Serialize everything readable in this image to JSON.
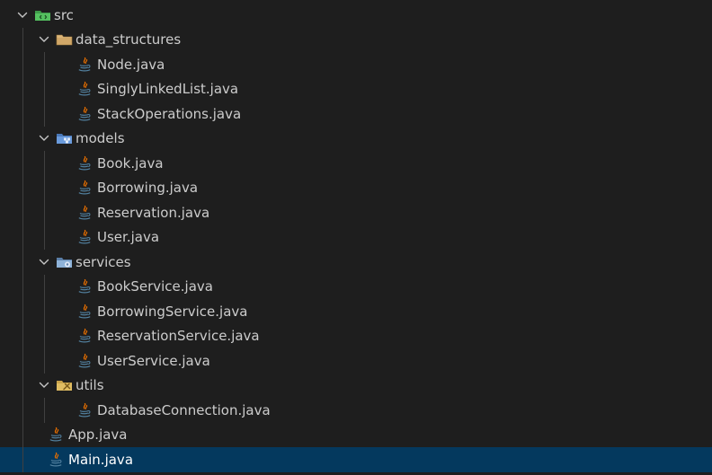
{
  "explorer": {
    "items": [
      {
        "label": "src",
        "kind": "folder",
        "icon": "src-folder-icon",
        "depth": 0,
        "expanded": true
      },
      {
        "label": "data_structures",
        "kind": "folder",
        "icon": "folder-icon",
        "depth": 1,
        "expanded": true
      },
      {
        "label": "Node.java",
        "kind": "file",
        "icon": "java-file-icon",
        "depth": 2
      },
      {
        "label": "SinglyLinkedList.java",
        "kind": "file",
        "icon": "java-file-icon",
        "depth": 2
      },
      {
        "label": "StackOperations.java",
        "kind": "file",
        "icon": "java-file-icon",
        "depth": 2
      },
      {
        "label": "models",
        "kind": "folder",
        "icon": "models-folder-icon",
        "depth": 1,
        "expanded": true
      },
      {
        "label": "Book.java",
        "kind": "file",
        "icon": "java-file-icon",
        "depth": 2
      },
      {
        "label": "Borrowing.java",
        "kind": "file",
        "icon": "java-file-icon",
        "depth": 2
      },
      {
        "label": "Reservation.java",
        "kind": "file",
        "icon": "java-file-icon",
        "depth": 2
      },
      {
        "label": "User.java",
        "kind": "file",
        "icon": "java-file-icon",
        "depth": 2
      },
      {
        "label": "services",
        "kind": "folder",
        "icon": "services-folder-icon",
        "depth": 1,
        "expanded": true
      },
      {
        "label": "BookService.java",
        "kind": "file",
        "icon": "java-file-icon",
        "depth": 2
      },
      {
        "label": "BorrowingService.java",
        "kind": "file",
        "icon": "java-file-icon",
        "depth": 2
      },
      {
        "label": "ReservationService.java",
        "kind": "file",
        "icon": "java-file-icon",
        "depth": 2
      },
      {
        "label": "UserService.java",
        "kind": "file",
        "icon": "java-file-icon",
        "depth": 2
      },
      {
        "label": "utils",
        "kind": "folder",
        "icon": "utils-folder-icon",
        "depth": 1,
        "expanded": true
      },
      {
        "label": "DatabaseConnection.java",
        "kind": "file",
        "icon": "java-file-icon",
        "depth": 2
      },
      {
        "label": "App.java",
        "kind": "file",
        "icon": "java-file-icon",
        "depth": 1
      },
      {
        "label": "Main.java",
        "kind": "file",
        "icon": "java-file-icon",
        "depth": 1,
        "selected": true
      }
    ]
  },
  "colors": {
    "background": "#1e1e1e",
    "text": "#cccccc",
    "selection": "#04395e",
    "indent_guide": "#404040",
    "folder": "#dcb67a",
    "java": "#e76f00",
    "src_folder": "#4caf50",
    "blue_folder": "#5b8fd1"
  }
}
